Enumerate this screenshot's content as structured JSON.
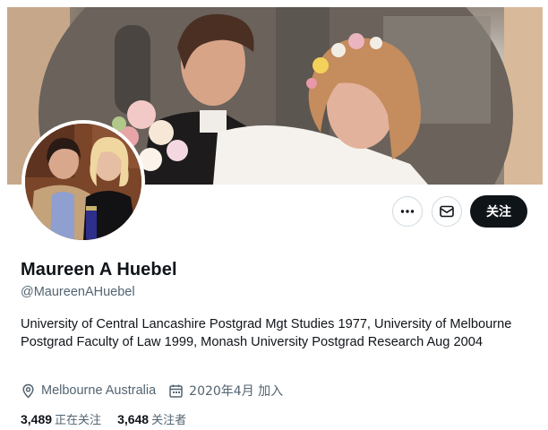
{
  "profile": {
    "display_name": "Maureen A Huebel",
    "handle": "@MaureenAHuebel",
    "bio": "University of Central Lancashire Postgrad Mgt Studies 1977, University of Melbourne Postgrad Faculty of Law 1999, Monash University Postgrad Research Aug 2004",
    "location": "Melbourne Australia",
    "joined": "2020年4月 加入"
  },
  "actions": {
    "more_icon": "more-horizontal-icon",
    "message_icon": "envelope-icon",
    "follow_label": "关注"
  },
  "stats": {
    "following_count": "3,489",
    "following_label": "正在关注",
    "followers_count": "3,648",
    "followers_label": "关注者"
  },
  "colors": {
    "primary_text": "#0f1419",
    "secondary_text": "#536471",
    "button_dark": "#0f1419",
    "border": "#cfd9de"
  }
}
